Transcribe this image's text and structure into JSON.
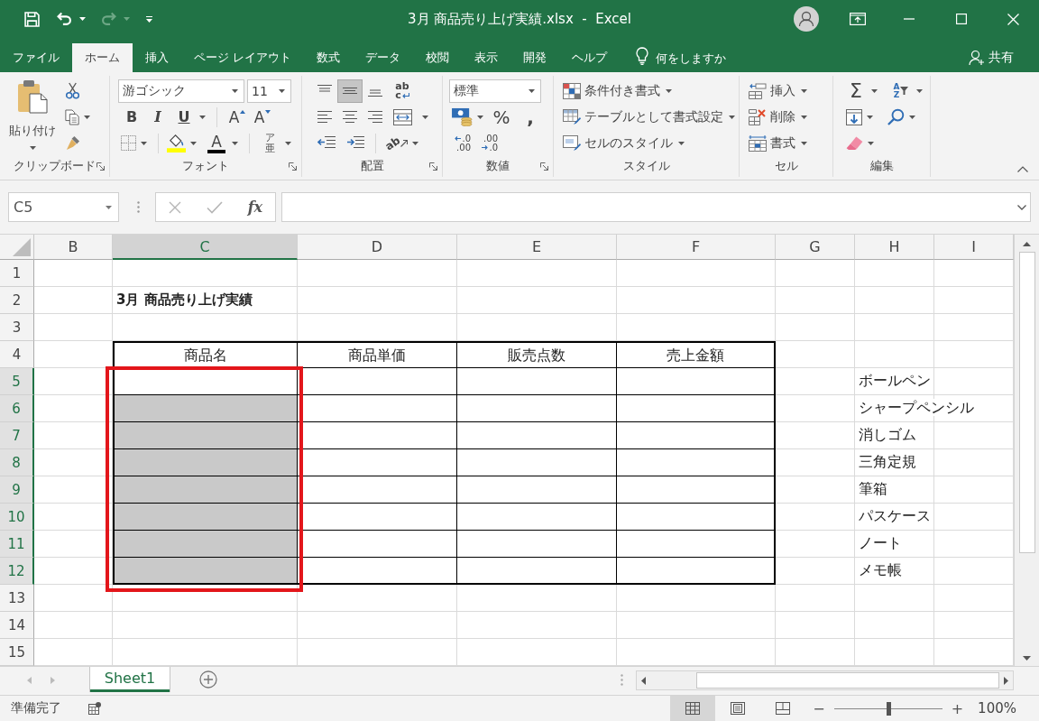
{
  "window": {
    "title": "3月 商品売り上げ実績.xlsx  -  Excel"
  },
  "quick_access": [
    {
      "kind": "save",
      "disabled": false
    },
    {
      "kind": "undo",
      "disabled": false
    },
    {
      "kind": "redo",
      "disabled": true
    },
    {
      "kind": "customize",
      "disabled": false
    }
  ],
  "ribbon_tabs": [
    {
      "label": "ファイル",
      "selected": false
    },
    {
      "label": "ホーム",
      "selected": true
    },
    {
      "label": "挿入",
      "selected": false
    },
    {
      "label": "ページ レイアウト",
      "selected": false
    },
    {
      "label": "数式",
      "selected": false
    },
    {
      "label": "データ",
      "selected": false
    },
    {
      "label": "校閲",
      "selected": false
    },
    {
      "label": "表示",
      "selected": false
    },
    {
      "label": "開発",
      "selected": false
    },
    {
      "label": "ヘルプ",
      "selected": false
    }
  ],
  "tell_me": {
    "placeholder": "何をしますか"
  },
  "share": {
    "label": "共有"
  },
  "clipboard": {
    "paste": "貼り付け",
    "label": "クリップボード"
  },
  "font": {
    "name": "游ゴシック",
    "size": "11",
    "bold": "B",
    "italic": "I",
    "underline": "U",
    "grow": "A",
    "shrink": "A",
    "color_letter": "A",
    "phonetic_top": "ア",
    "phonetic_bottom": "亜",
    "label": "フォント"
  },
  "alignment": {
    "vertical": [
      {
        "kind": "top",
        "selected": false
      },
      {
        "kind": "middle",
        "selected": true
      },
      {
        "kind": "bottom",
        "selected": false
      }
    ],
    "wrap_top": "ab",
    "wrap_bottom": "c",
    "orientation": "ab",
    "label": "配置"
  },
  "number": {
    "format": "標準",
    "percent": "%",
    "comma": ",",
    "increase_decimal": [
      ".0",
      ".00"
    ],
    "decrease_decimal": [
      ".00",
      ".0"
    ],
    "label": "数値"
  },
  "styles": {
    "items": [
      {
        "kind": "conditional",
        "label": "条件付き書式"
      },
      {
        "kind": "table",
        "label": "テーブルとして書式設定"
      },
      {
        "kind": "cell_style",
        "label": "セルのスタイル"
      }
    ],
    "label": "スタイル"
  },
  "cells": {
    "items": [
      {
        "kind": "insert",
        "label": "挿入"
      },
      {
        "kind": "delete",
        "label": "削除"
      },
      {
        "kind": "format",
        "label": "書式"
      }
    ],
    "label": "セル"
  },
  "editing": {
    "sum": "Σ",
    "sort_top": "A",
    "sort_bottom": "Z",
    "label": "編集"
  },
  "formula_bar": {
    "name_box": "C5",
    "function_label": "fx"
  },
  "sheet": {
    "columns": [
      {
        "label": "B",
        "selected": false
      },
      {
        "label": "C",
        "selected": true
      },
      {
        "label": "D",
        "selected": false
      },
      {
        "label": "E",
        "selected": false
      },
      {
        "label": "F",
        "selected": false
      },
      {
        "label": "G",
        "selected": false
      },
      {
        "label": "H",
        "selected": false
      },
      {
        "label": "I",
        "selected": false
      }
    ],
    "rows": [
      {
        "label": "1",
        "selected": false,
        "active": false
      },
      {
        "label": "2",
        "selected": false,
        "active": false
      },
      {
        "label": "3",
        "selected": false,
        "active": false
      },
      {
        "label": "4",
        "selected": false,
        "active": false
      },
      {
        "label": "5",
        "selected": true,
        "active": true
      },
      {
        "label": "6",
        "selected": true,
        "active": false
      },
      {
        "label": "7",
        "selected": true,
        "active": false
      },
      {
        "label": "8",
        "selected": true,
        "active": false
      },
      {
        "label": "9",
        "selected": true,
        "active": false
      },
      {
        "label": "10",
        "selected": true,
        "active": false
      },
      {
        "label": "11",
        "selected": true,
        "active": false
      },
      {
        "label": "12",
        "selected": true,
        "active": false
      },
      {
        "label": "13",
        "selected": false,
        "active": false
      },
      {
        "label": "14",
        "selected": false,
        "active": false
      },
      {
        "label": "15",
        "selected": false,
        "active": false
      }
    ],
    "title": "3月 商品売り上げ実績",
    "table_headers": [
      "商品名",
      "商品単価",
      "販売点数",
      "売上金額"
    ],
    "product_list": [
      "ボールペン",
      "シャープペンシル",
      "消しゴム",
      "三角定規",
      "筆箱",
      "パスケース",
      "ノート",
      "メモ帳"
    ]
  },
  "sheet_tabs": [
    {
      "label": "Sheet1",
      "selected": true
    }
  ],
  "status_bar": {
    "text": "準備完了",
    "views": [
      {
        "kind": "normal",
        "selected": true
      },
      {
        "kind": "page_layout",
        "selected": false
      },
      {
        "kind": "page_break",
        "selected": false
      }
    ],
    "zoom_out": "−",
    "zoom_in": "+",
    "zoom": {
      "level": 0.5,
      "reading": "100%"
    }
  }
}
